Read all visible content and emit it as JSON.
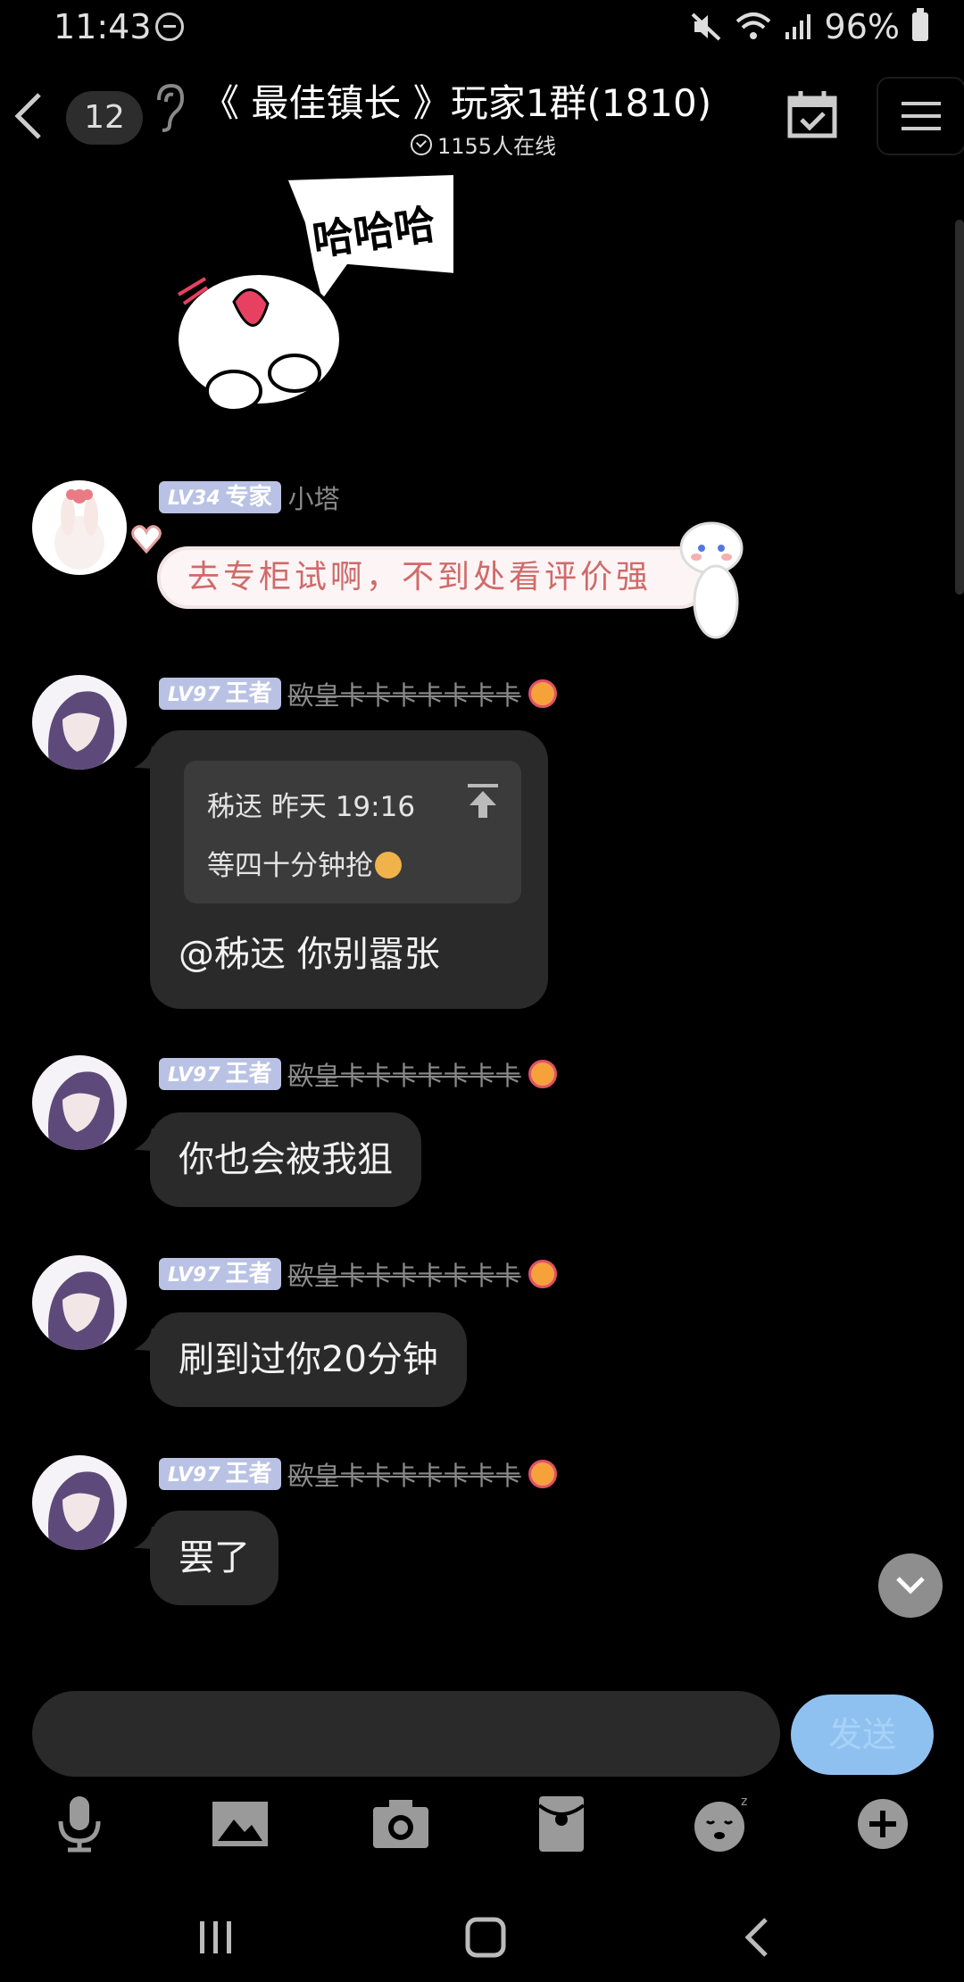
{
  "status_bar": {
    "time": "11:43",
    "battery": "96%"
  },
  "header": {
    "unread_count": "12",
    "title": "《 最佳镇长 》玩家1群(1810)",
    "online": "1155人在线"
  },
  "messages": [
    {
      "level": "LV34",
      "rank": "专家",
      "name": "小塔",
      "text": "去专柜试啊，不到处看评价强"
    },
    {
      "level": "LV97",
      "rank": "王者",
      "name": "欧皇卡卡卡卡卡卡卡",
      "quote": {
        "author_time": "秭迗 昨天 19:16",
        "text": "等四十分钟抢"
      },
      "text": "@秭迗 你别嚣张"
    },
    {
      "level": "LV97",
      "rank": "王者",
      "name": "欧皇卡卡卡卡卡卡卡",
      "text": "你也会被我狙"
    },
    {
      "level": "LV97",
      "rank": "王者",
      "name": "欧皇卡卡卡卡卡卡卡",
      "text": "刷到过你20分钟"
    },
    {
      "level": "LV97",
      "rank": "王者",
      "name": "欧皇卡卡卡卡卡卡卡",
      "text": "罢了"
    }
  ],
  "sticker_text": "哈哈哈",
  "composer": {
    "send_label": "发送",
    "placeholder": ""
  },
  "colors": {
    "bubble": "#2a2a2a",
    "level_badge": "#b9c2e4",
    "send_button": "#8fc1f0",
    "background": "#000000"
  },
  "icons": [
    "back-icon",
    "ear-icon",
    "calendar-check-icon",
    "menu-icon",
    "pin-top-icon",
    "chevron-down-icon",
    "microphone-icon",
    "image-icon",
    "camera-icon",
    "red-packet-icon",
    "emoji-icon",
    "plus-icon"
  ]
}
